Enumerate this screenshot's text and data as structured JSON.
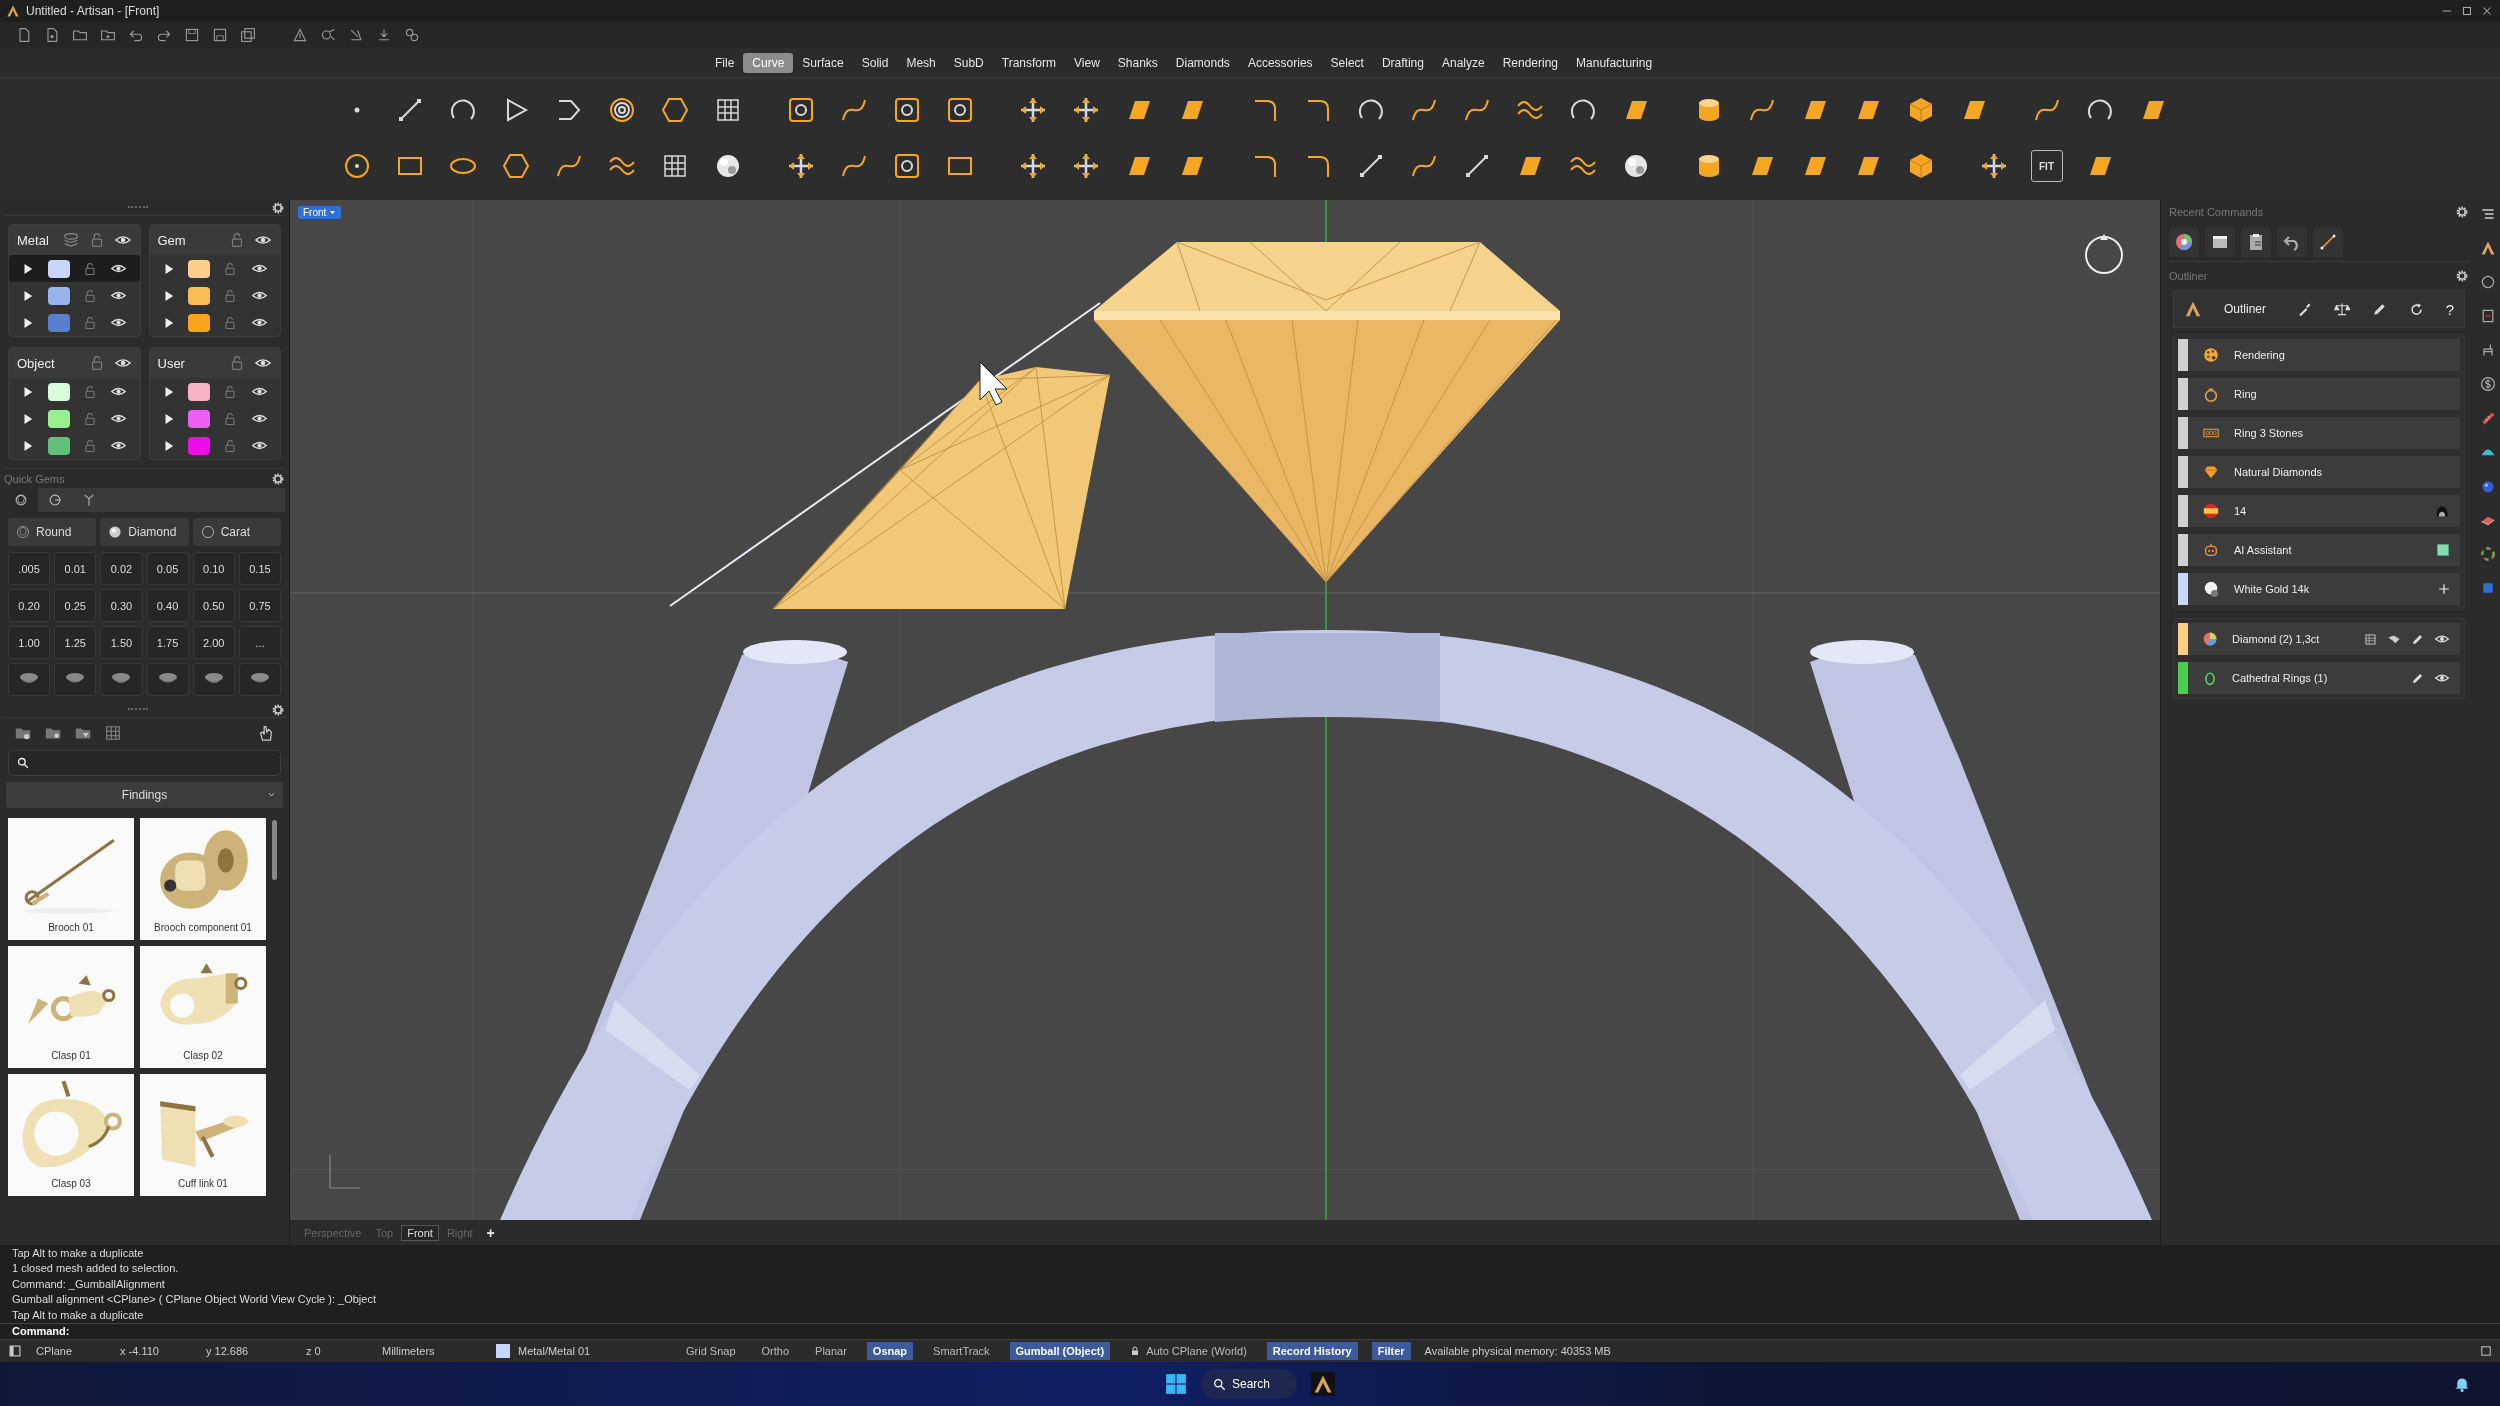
{
  "window": {
    "title": "Untitled - Artisan - [Front]"
  },
  "menu": [
    {
      "label": "File",
      "selected": false
    },
    {
      "label": "Curve",
      "selected": true
    },
    {
      "label": "Surface",
      "selected": false
    },
    {
      "label": "Solid",
      "selected": false
    },
    {
      "label": "Mesh",
      "selected": false
    },
    {
      "label": "SubD",
      "selected": false
    },
    {
      "label": "Transform",
      "selected": false
    },
    {
      "label": "View",
      "selected": false
    },
    {
      "label": "Shanks",
      "selected": false
    },
    {
      "label": "Diamonds",
      "selected": false
    },
    {
      "label": "Accessories",
      "selected": false
    },
    {
      "label": "Select",
      "selected": false
    },
    {
      "label": "Drafting",
      "selected": false
    },
    {
      "label": "Analyze",
      "selected": false
    },
    {
      "label": "Rendering",
      "selected": false
    },
    {
      "label": "Manufacturing",
      "selected": false
    }
  ],
  "toolbar": {
    "fit_label": "FIT"
  },
  "layers": [
    {
      "name": "Metal",
      "kind": "metal",
      "rows": [
        {
          "color": "#c9d6fb",
          "selected": true
        },
        {
          "color": "#97b4ee",
          "selected": false
        },
        {
          "color": "#5a7fd0",
          "selected": false
        }
      ]
    },
    {
      "name": "Gem",
      "kind": "plain",
      "rows": [
        {
          "color": "#fcd08a",
          "selected": false
        },
        {
          "color": "#fbbd55",
          "selected": false
        },
        {
          "color": "#f7a51a",
          "selected": false
        }
      ]
    },
    {
      "name": "Object",
      "kind": "plain",
      "rows": [
        {
          "color": "#d9fbd9",
          "selected": false
        },
        {
          "color": "#9af08f",
          "selected": false
        },
        {
          "color": "#63c07a",
          "selected": false
        }
      ]
    },
    {
      "name": "User",
      "kind": "plain",
      "rows": [
        {
          "color": "#f7b3c6",
          "selected": false
        },
        {
          "color": "#ec5ff0",
          "selected": false
        },
        {
          "color": "#ec0ded",
          "selected": false
        }
      ]
    }
  ],
  "quick_gems": {
    "title": "Quick Gems",
    "tabs": [
      {
        "selected": true
      },
      {
        "selected": false
      },
      {
        "selected": false
      }
    ],
    "shape": "Round",
    "material": "Diamond",
    "unit": "Carat",
    "sizes": [
      ".005",
      "0.01",
      "0.02",
      "0.05",
      "0.10",
      "0.15",
      "0.20",
      "0.25",
      "0.30",
      "0.40",
      "0.50",
      "0.75",
      "1.00",
      "1.25",
      "1.50",
      "1.75",
      "2.00",
      "..."
    ]
  },
  "library": {
    "category": "Findings",
    "items": [
      {
        "label": "Brooch 01"
      },
      {
        "label": "Brooch component 01"
      },
      {
        "label": "Clasp 01"
      },
      {
        "label": "Clasp 02"
      },
      {
        "label": "Clasp 03"
      },
      {
        "label": "Cuff link 01"
      }
    ]
  },
  "viewport": {
    "name": "Front",
    "tabs": [
      {
        "label": "Perspective",
        "selected": false
      },
      {
        "label": "Top",
        "selected": false
      },
      {
        "label": "Front",
        "selected": true
      },
      {
        "label": "Right",
        "selected": false
      }
    ],
    "add_tab": "+"
  },
  "recent_commands": {
    "title": "Recent Commands"
  },
  "outliner": {
    "panel_title": "Outliner",
    "title": "Outliner",
    "help": "?",
    "items": [
      {
        "label": "Rendering",
        "color": "#d0d0d0"
      },
      {
        "label": "Ring",
        "color": "#d0d0d0"
      },
      {
        "label": "Ring 3 Stones",
        "color": "#d0d0d0"
      },
      {
        "label": "Natural Diamonds",
        "color": "#d0d0d0"
      },
      {
        "label": "14",
        "color": "#d0d0d0"
      },
      {
        "label": "AI Assistant",
        "color": "#d0d0d0"
      },
      {
        "label": "White Gold 14k",
        "color": "#c9d6fb"
      }
    ],
    "objects": [
      {
        "label": "Diamond (2) 1,3ct",
        "color": "#f9cd85"
      },
      {
        "label": "Cathedral Rings (1)",
        "color": "#4ccc4c"
      }
    ]
  },
  "command_history": [
    "Tap Alt to make a duplicate",
    "1 closed mesh added to selection.",
    "Command: _GumballAlignment",
    "Gumball alignment <CPlane> ( CPlane  Object  World  View  Cycle ): _Object",
    "Tap Alt to make a duplicate"
  ],
  "command_prompt": "Command:",
  "status_bar": {
    "cplane": "CPlane",
    "x": "x -4.110",
    "y": "y 12.686",
    "z": "z 0",
    "units": "Millimeters",
    "layer": {
      "label": "Metal/Metal 01",
      "color": "#c9d6fb"
    },
    "toggles": [
      {
        "label": "Grid Snap",
        "kind": "toggle",
        "on": false
      },
      {
        "label": "Ortho",
        "kind": "toggle",
        "on": false
      },
      {
        "label": "Planar",
        "kind": "toggle",
        "on": false
      },
      {
        "label": "Osnap",
        "kind": "toggle",
        "on": true
      },
      {
        "label": "SmartTrack",
        "kind": "toggle",
        "on": false
      },
      {
        "label": "Gumball (Object)",
        "kind": "toggle",
        "on": true
      },
      {
        "label": "Auto CPlane (World)",
        "kind": "lock",
        "on": false
      },
      {
        "label": "Record History",
        "kind": "toggle",
        "on": true
      },
      {
        "label": "Filter",
        "kind": "toggle",
        "on": true
      }
    ],
    "memory": "Available physical memory: 40353 MB"
  },
  "taskbar": {
    "search": "Search"
  }
}
